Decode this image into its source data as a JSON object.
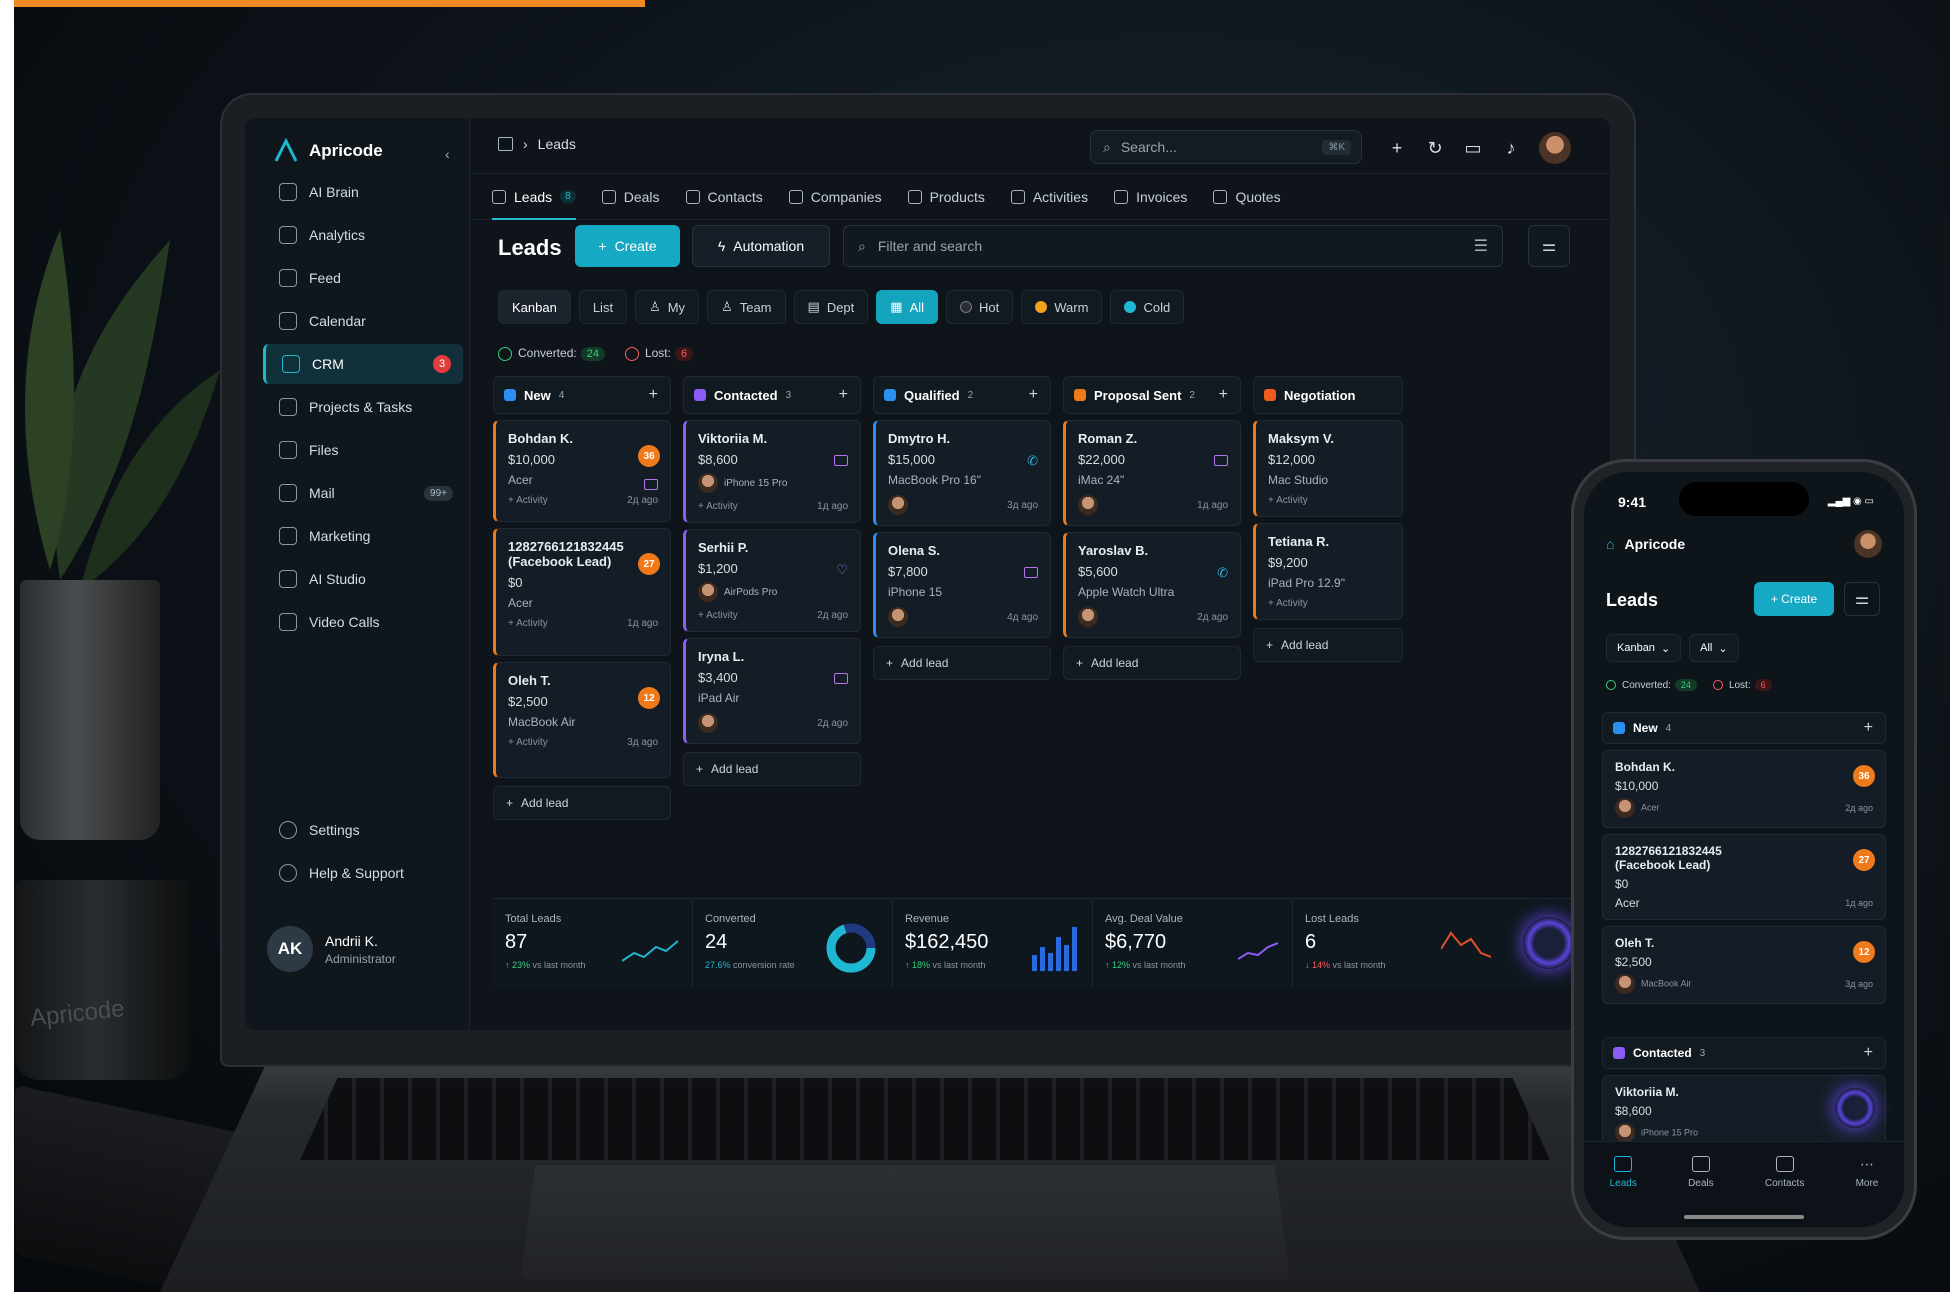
{
  "app": {
    "name": "Apricode"
  },
  "sidebar": {
    "items": [
      {
        "label": "AI Brain"
      },
      {
        "label": "Analytics"
      },
      {
        "label": "Feed"
      },
      {
        "label": "Calendar"
      },
      {
        "label": "CRM",
        "badge": "3"
      },
      {
        "label": "Projects & Tasks"
      },
      {
        "label": "Files"
      },
      {
        "label": "Mail",
        "badge": "99+"
      },
      {
        "label": "Marketing"
      },
      {
        "label": "AI Studio"
      },
      {
        "label": "Video Calls"
      }
    ],
    "bottom": [
      {
        "label": "Settings"
      },
      {
        "label": "Help & Support"
      }
    ],
    "user": {
      "initials": "AK",
      "name": "Andrii K.",
      "role": "Administrator"
    }
  },
  "topbar": {
    "breadcrumb": "Leads",
    "search_placeholder": "Search...",
    "search_shortcut": "⌘K"
  },
  "tabs": [
    {
      "label": "Leads",
      "count": "8"
    },
    {
      "label": "Deals"
    },
    {
      "label": "Contacts"
    },
    {
      "label": "Companies"
    },
    {
      "label": "Products"
    },
    {
      "label": "Activities"
    },
    {
      "label": "Invoices"
    },
    {
      "label": "Quotes"
    }
  ],
  "header": {
    "title": "Leads",
    "create_label": "Create",
    "automation_label": "Automation",
    "filter_placeholder": "Filter and search"
  },
  "views": {
    "kanban": "Kanban",
    "list": "List",
    "my": "My",
    "team": "Team",
    "dept": "Dept",
    "all": "All",
    "hot": "Hot",
    "warm": "Warm",
    "cold": "Cold"
  },
  "summary": {
    "converted_label": "Converted:",
    "converted": "24",
    "lost_label": "Lost:",
    "lost": "6"
  },
  "columns": [
    {
      "title": "New",
      "count": "4",
      "color": "#2a8ff0",
      "cards": [
        {
          "name": "Bohdan K.",
          "amount": "$10,000",
          "product": "Acer",
          "score": "36",
          "activity": "Activity",
          "time": "2д ago"
        },
        {
          "name": "1282766121832445 (Facebook Lead)",
          "amount": "$0",
          "product": "Acer",
          "score": "27",
          "activity": "Activity",
          "time": "1д ago"
        },
        {
          "name": "Oleh T.",
          "amount": "$2,500",
          "product": "MacBook Air",
          "score": "12",
          "activity": "Activity",
          "time": "3д ago"
        }
      ]
    },
    {
      "title": "Contacted",
      "count": "3",
      "color": "#8b5cf6",
      "cards": [
        {
          "name": "Viktoriia M.",
          "amount": "$8,600",
          "product": "iPhone 15 Pro",
          "activity": "Activity",
          "time": "1д ago"
        },
        {
          "name": "Serhii P.",
          "amount": "$1,200",
          "product": "AirPods Pro",
          "activity": "Activity",
          "time": "2д ago"
        },
        {
          "name": "Iryna L.",
          "amount": "$3,400",
          "product": "iPad Air",
          "time": "2д ago"
        }
      ]
    },
    {
      "title": "Qualified",
      "count": "2",
      "color": "#2a8ff0",
      "cards": [
        {
          "name": "Dmytro H.",
          "amount": "$15,000",
          "product": "MacBook Pro 16\"",
          "time": "3д ago"
        },
        {
          "name": "Olena S.",
          "amount": "$7,800",
          "product": "iPhone 15",
          "time": "4д ago"
        }
      ]
    },
    {
      "title": "Proposal Sent",
      "count": "2",
      "color": "#f07a1a",
      "cards": [
        {
          "name": "Roman Z.",
          "amount": "$22,000",
          "product": "iMac 24\"",
          "time": "1д ago"
        },
        {
          "name": "Yaroslav B.",
          "amount": "$5,600",
          "product": "Apple Watch Ultra",
          "time": "2д ago"
        }
      ]
    },
    {
      "title": "Negotiation",
      "color": "#f05a1a",
      "cards": [
        {
          "name": "Maksym V.",
          "amount": "$12,000",
          "product": "Mac Studio",
          "activity": "Activity"
        },
        {
          "name": "Tetiana R.",
          "amount": "$9,200",
          "product": "iPad Pro 12.9\"",
          "activity": "Activity"
        }
      ]
    }
  ],
  "add_lead": "Add lead",
  "stats": [
    {
      "label": "Total Leads",
      "value": "87",
      "delta": "↑ 23%",
      "sub": "vs last month"
    },
    {
      "label": "Converted",
      "value": "24",
      "delta": "27.6%",
      "sub": "conversion rate"
    },
    {
      "label": "Revenue",
      "value": "$162,450",
      "delta": "↑ 18%",
      "sub": "vs last month"
    },
    {
      "label": "Avg. Deal Value",
      "value": "$6,770",
      "delta": "↑ 12%",
      "sub": "vs last month"
    },
    {
      "label": "Lost Leads",
      "value": "6",
      "delta": "↓ 14%",
      "sub": "vs last month"
    }
  ],
  "phone": {
    "time": "9:41",
    "brand": "Apricode",
    "title": "Leads",
    "create": "+ Create",
    "view": "Kanban",
    "filter": "All",
    "converted_label": "Converted:",
    "converted": "24",
    "lost_label": "Lost:",
    "lost": "6",
    "new_col": {
      "title": "New",
      "count": "4"
    },
    "contacted_col": {
      "title": "Contacted",
      "count": "3"
    },
    "cards": [
      {
        "name": "Bohdan K.",
        "amount": "$10,000",
        "product": "Acer",
        "score": "36",
        "time": "2д ago"
      },
      {
        "name": "1282766121832445 (Facebook Lead)",
        "amount": "$0",
        "product": "Acer",
        "score": "27",
        "time": "1д ago"
      },
      {
        "name": "Oleh T.",
        "amount": "$2,500",
        "product": "MacBook Air",
        "score": "12",
        "time": "3д ago"
      }
    ],
    "contacted_card": {
      "name": "Viktoriia M.",
      "amount": "$8,600",
      "product": "iPhone 15 Pro"
    },
    "nav": [
      "Leads",
      "Deals",
      "Contacts",
      "More"
    ]
  },
  "mug_logo": "Apricode",
  "colors": {
    "accent": "#16a9c4",
    "orange": "#f07a1a",
    "purple": "#8b5cf6"
  }
}
